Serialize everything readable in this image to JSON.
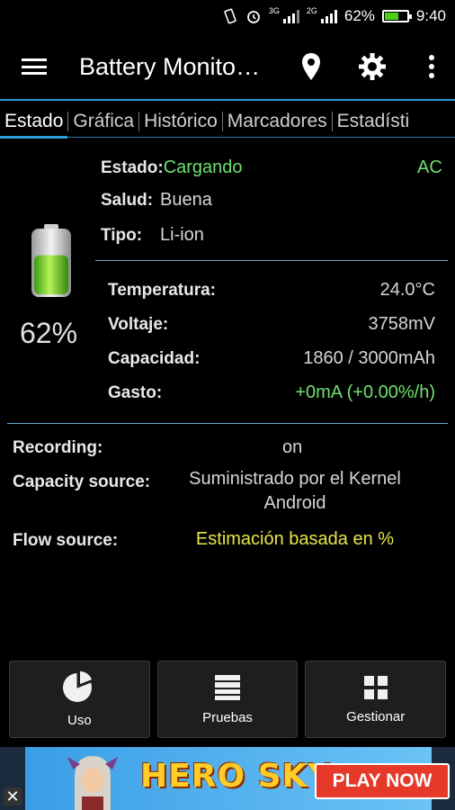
{
  "status_bar": {
    "signal_3g": "3G",
    "signal_2g": "2G",
    "battery_percent": "62%",
    "battery_level": 0.62,
    "time": "9:40"
  },
  "toolbar": {
    "title": "Battery Monito…",
    "icons": [
      "menu-icon",
      "location-pin-icon",
      "gear-icon",
      "more-vertical-icon"
    ]
  },
  "tabs": [
    {
      "label": "Estado",
      "active": true
    },
    {
      "label": "Gráfica",
      "active": false
    },
    {
      "label": "Histórico",
      "active": false
    },
    {
      "label": "Marcadores",
      "active": false
    },
    {
      "label": "Estadísti",
      "active": false
    }
  ],
  "battery": {
    "percent": "62%",
    "level": 0.62,
    "estado_label": "Estado:",
    "estado_value": "Cargando",
    "source": "AC",
    "salud_label": "Salud:",
    "salud_value": "Buena",
    "tipo_label": "Tipo:",
    "tipo_value": "Li-ion"
  },
  "metrics": {
    "temperatura_label": "Temperatura:",
    "temperatura_value": "24.0°C",
    "voltaje_label": "Voltaje:",
    "voltaje_value": "3758mV",
    "capacidad_label": "Capacidad:",
    "capacidad_value": "1860 / 3000mAh",
    "gasto_label": "Gasto:",
    "gasto_value": "+0mA (+0.00%/h)"
  },
  "info": {
    "recording_label": "Recording:",
    "recording_value": "on",
    "capacity_source_label": "Capacity source:",
    "capacity_source_line1": "Suministrado por el Kernel",
    "capacity_source_line2": "Android",
    "flow_source_label": "Flow source:",
    "flow_source_value": "Estimación basada en %"
  },
  "bottom_buttons": [
    {
      "label": "Uso",
      "icon": "pie-chart-icon"
    },
    {
      "label": "Pruebas",
      "icon": "list-icon"
    },
    {
      "label": "Gestionar",
      "icon": "grid-icon"
    }
  ],
  "ad": {
    "title": "HERO SKY",
    "cta": "PLAY NOW",
    "close": "✕"
  },
  "colors": {
    "accent": "#2f9bd8",
    "green": "#6fe06f",
    "yellow": "#e7e64a",
    "background": "#000000"
  }
}
